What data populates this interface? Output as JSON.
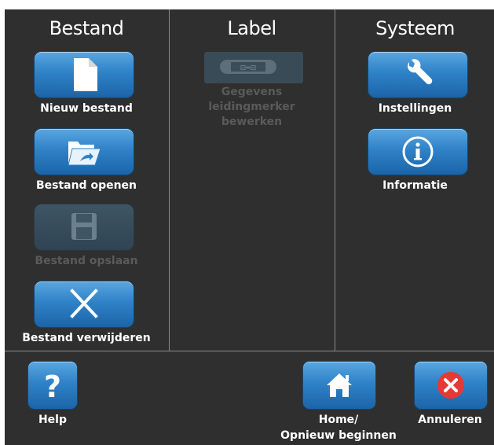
{
  "columns": {
    "file": {
      "title": "Bestand",
      "items": [
        {
          "label": "Nieuw bestand",
          "icon": "new-file-icon",
          "enabled": true
        },
        {
          "label": "Bestand openen",
          "icon": "open-folder-icon",
          "enabled": true
        },
        {
          "label": "Bestand opslaan",
          "icon": "save-disk-icon",
          "enabled": false
        },
        {
          "label": "Bestand verwijderen",
          "icon": "delete-x-icon",
          "enabled": true
        }
      ]
    },
    "label": {
      "title": "Label",
      "items": [
        {
          "label_lines": [
            "Gegevens",
            "leidingmerker",
            "bewerken"
          ],
          "icon": "pipe-marker-icon",
          "enabled": false
        }
      ]
    },
    "system": {
      "title": "Systeem",
      "items": [
        {
          "label": "Instellingen",
          "icon": "wrench-icon",
          "enabled": true
        },
        {
          "label": "Informatie",
          "icon": "info-icon",
          "enabled": true
        }
      ]
    }
  },
  "bottom": {
    "help": {
      "label": "Help",
      "icon": "question-icon"
    },
    "home": {
      "label_lines": [
        "Home/",
        "Opnieuw beginnen"
      ],
      "icon": "home-icon"
    },
    "cancel": {
      "label": "Annuleren",
      "icon": "cancel-icon"
    }
  },
  "colors": {
    "background": "#2f2f2f",
    "button_blue": "#2f82c8",
    "disabled": "#5a5a5a",
    "cancel_red": "#e53935"
  }
}
